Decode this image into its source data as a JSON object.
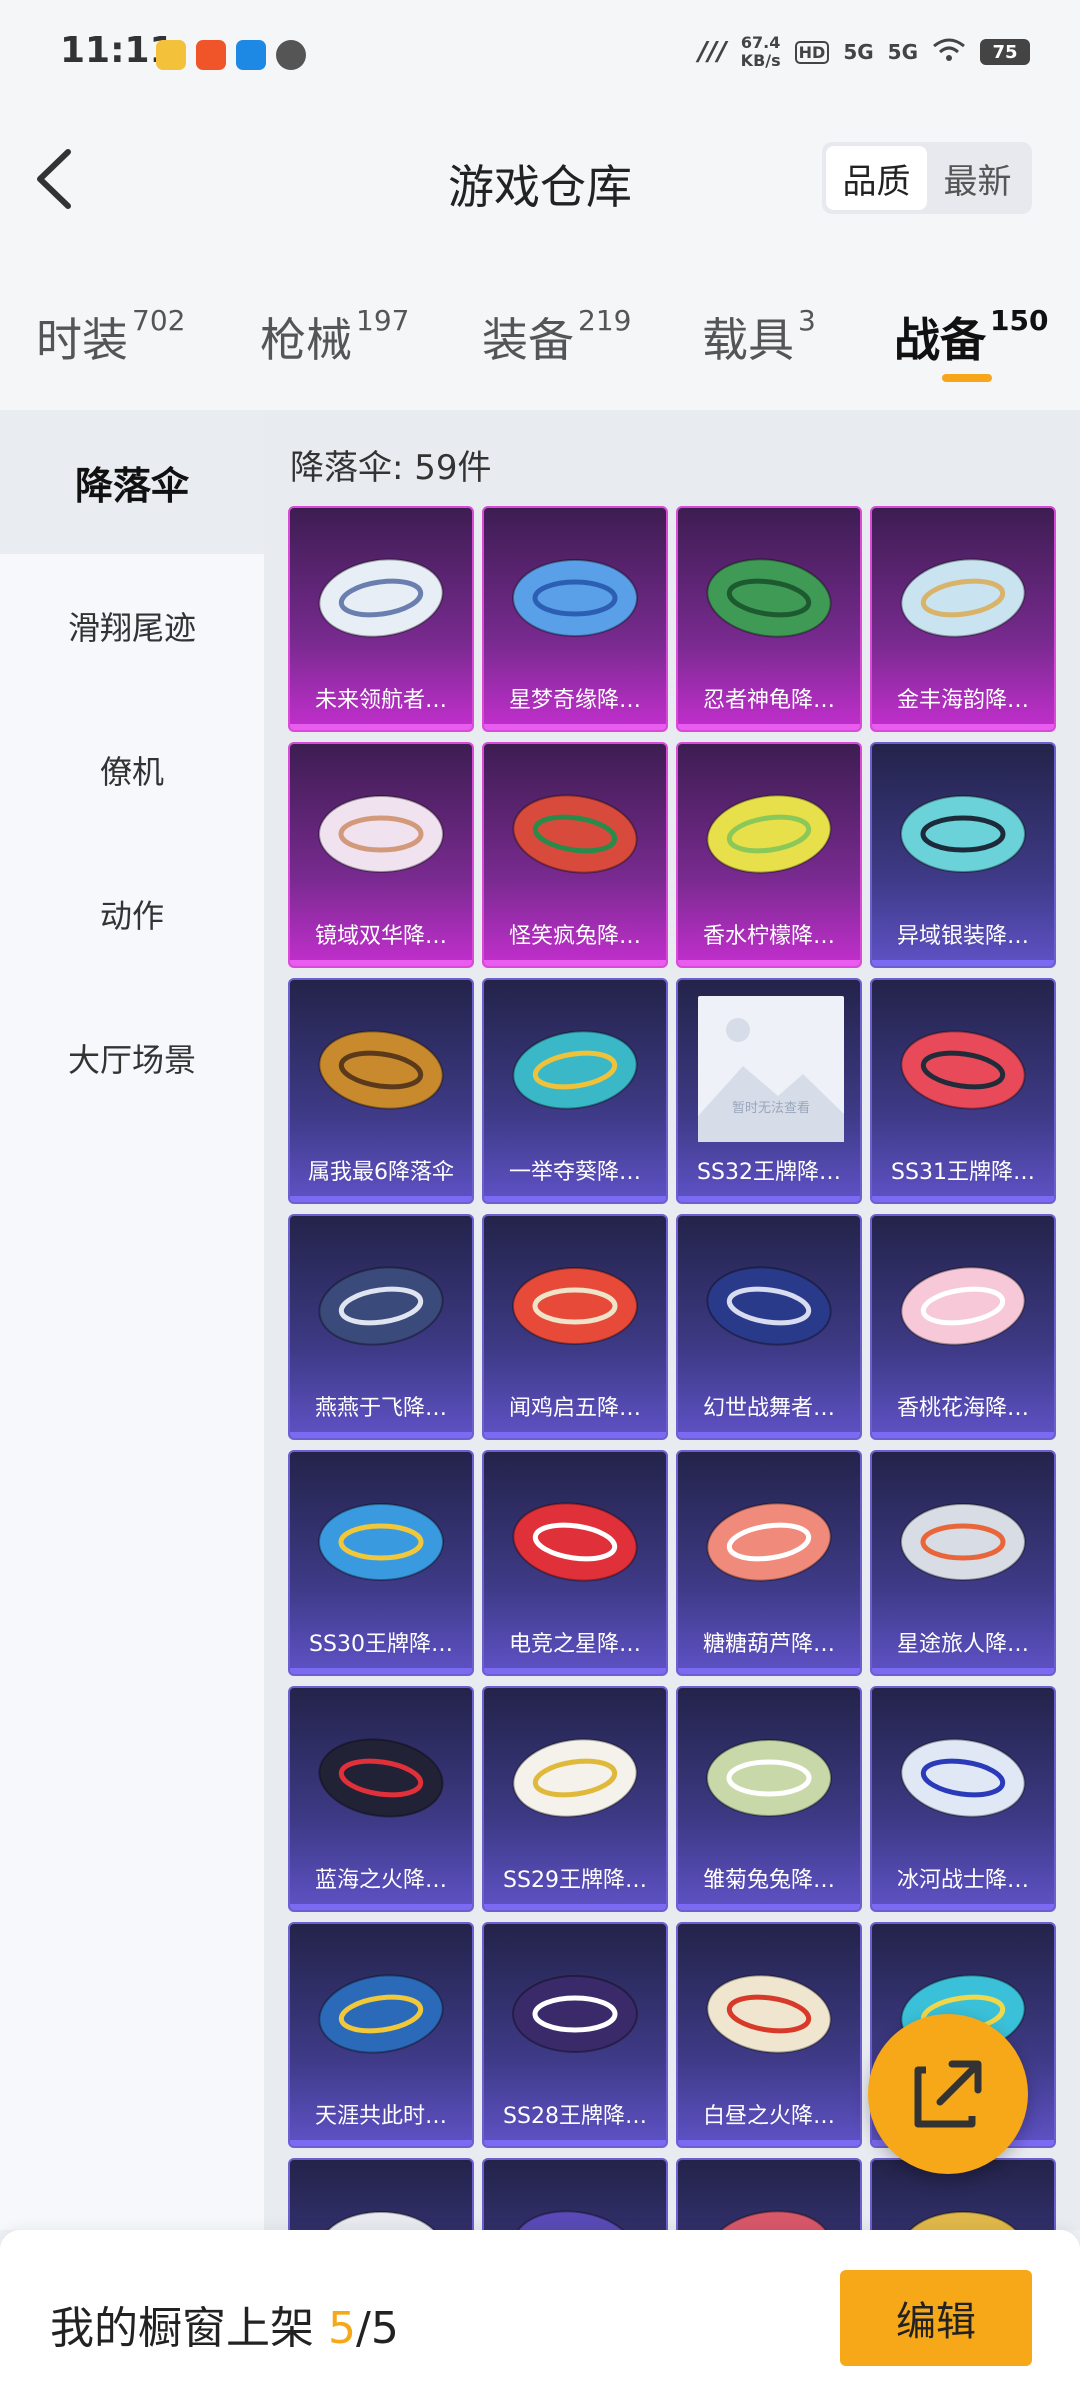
{
  "status_bar": {
    "time": "11:11",
    "speed_value": "67.4",
    "speed_unit": "KB/s",
    "hd": "HD",
    "net1": "5G",
    "net2": "5G",
    "battery": "75"
  },
  "header": {
    "title": "游戏仓库",
    "sort_options": [
      "品质",
      "最新"
    ],
    "sort_selected": "品质"
  },
  "tabs": [
    {
      "label": "时装",
      "count": "702"
    },
    {
      "label": "枪械",
      "count": "197"
    },
    {
      "label": "装备",
      "count": "219"
    },
    {
      "label": "载具",
      "count": "3"
    },
    {
      "label": "战备",
      "count": "150"
    }
  ],
  "active_tab": "战备",
  "sidebar": {
    "items": [
      "降落伞",
      "滑翔尾迹",
      "僚机",
      "动作",
      "大厅场景"
    ],
    "active": "降落伞"
  },
  "content": {
    "count_label": "降落伞: 59件",
    "placeholder_text": "暂时无法查看",
    "items": [
      {
        "name": "未来领航者…",
        "tier": "pink",
        "color": "#e8eef6",
        "accent": "#6a7fb0"
      },
      {
        "name": "星梦奇缘降…",
        "tier": "pink",
        "color": "#5aa0e8",
        "accent": "#2c5fb3"
      },
      {
        "name": "忍者神龟降…",
        "tier": "pink",
        "color": "#3f9a56",
        "accent": "#1e5a2f"
      },
      {
        "name": "金丰海韵降…",
        "tier": "pink",
        "color": "#c9e4f0",
        "accent": "#d9b36a"
      },
      {
        "name": "镜域双华降…",
        "tier": "pink",
        "color": "#f1e2f0",
        "accent": "#d29a7a"
      },
      {
        "name": "怪笑疯兔降…",
        "tier": "pink",
        "color": "#d84a3c",
        "accent": "#2a8a4a"
      },
      {
        "name": "香水柠檬降…",
        "tier": "pink",
        "color": "#e8e04a",
        "accent": "#8ac85a"
      },
      {
        "name": "异域银装降…",
        "tier": "purple",
        "color": "#6ad2d8",
        "accent": "#1c2a3a"
      },
      {
        "name": "属我最6降落伞",
        "tier": "purple",
        "color": "#c88a2c",
        "accent": "#5a3a1a"
      },
      {
        "name": "一举夺葵降…",
        "tier": "purple",
        "color": "#3ab8c8",
        "accent": "#f0c23a"
      },
      {
        "name": "SS32王牌降…",
        "tier": "purple",
        "color": "",
        "accent": ""
      },
      {
        "name": "SS31王牌降…",
        "tier": "purple",
        "color": "#e84a5a",
        "accent": "#222b3a"
      },
      {
        "name": "燕燕于飞降…",
        "tier": "purple",
        "color": "#3a4a7a",
        "accent": "#e0e4f0"
      },
      {
        "name": "闻鸡启五降…",
        "tier": "purple",
        "color": "#e84a3a",
        "accent": "#f0e4c8"
      },
      {
        "name": "幻世战舞者…",
        "tier": "purple",
        "color": "#2a3a8a",
        "accent": "#d8dcf0"
      },
      {
        "name": "香桃花海降…",
        "tier": "purple",
        "color": "#f6c8d8",
        "accent": "#ffffff"
      },
      {
        "name": "SS30王牌降…",
        "tier": "purple",
        "color": "#3a9ae0",
        "accent": "#f0c83a"
      },
      {
        "name": "电竞之星降…",
        "tier": "purple",
        "color": "#e0303a",
        "accent": "#ffffff"
      },
      {
        "name": "糖糖葫芦降…",
        "tier": "purple",
        "color": "#f08a7a",
        "accent": "#ffffff"
      },
      {
        "name": "星途旅人降…",
        "tier": "purple",
        "color": "#d8dce4",
        "accent": "#e8663a"
      },
      {
        "name": "蓝海之火降…",
        "tier": "purple",
        "color": "#222236",
        "accent": "#e0303a"
      },
      {
        "name": "SS29王牌降…",
        "tier": "purple",
        "color": "#f4f2ea",
        "accent": "#e0b83a"
      },
      {
        "name": "雏菊兔兔降…",
        "tier": "purple",
        "color": "#c8d8a8",
        "accent": "#ffffff"
      },
      {
        "name": "冰河战士降…",
        "tier": "purple",
        "color": "#e0e8f6",
        "accent": "#2a3ab8"
      },
      {
        "name": "天涯共此时…",
        "tier": "purple",
        "color": "#2a6ab8",
        "accent": "#f0c83a"
      },
      {
        "name": "SS28王牌降…",
        "tier": "purple",
        "color": "#3a2a6a",
        "accent": "#ffffff"
      },
      {
        "name": "白昼之火降…",
        "tier": "purple",
        "color": "#f0e6d0",
        "accent": "#d83a2a"
      },
      {
        "name": "",
        "tier": "purple",
        "color": "#3ac0d8",
        "accent": "#f0d84a"
      },
      {
        "name": "",
        "tier": "purple",
        "color": "#e8eaf0",
        "accent": "#d83a3a"
      },
      {
        "name": "",
        "tier": "purple",
        "color": "#5a4ab8",
        "accent": "#e8e4f6"
      },
      {
        "name": "",
        "tier": "purple",
        "color": "#d8586a",
        "accent": "#2a2a4a"
      },
      {
        "name": "",
        "tier": "purple",
        "color": "#e0b84a",
        "accent": "#2a2a2a"
      }
    ]
  },
  "bottom_bar": {
    "label_prefix": "我的橱窗上架",
    "current": "5",
    "separator": "/",
    "total": "5",
    "edit_button": "编辑"
  },
  "colors": {
    "accent": "#f6a818",
    "pink_tier": "#c32fce",
    "purple_tier": "#5f52c6"
  }
}
